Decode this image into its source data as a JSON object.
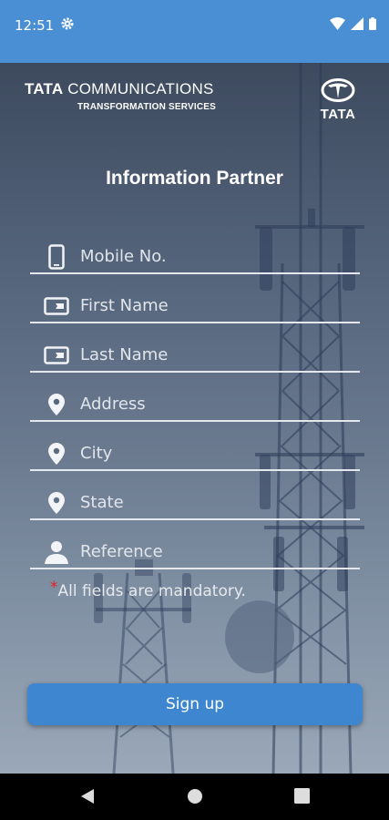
{
  "status_bar": {
    "time": "12:51"
  },
  "header": {
    "brand_bold": "TATA",
    "brand_rest": "COMMUNICATIONS",
    "brand_sub": "TRANSFORMATION SERVICES",
    "logo_word": "TATA"
  },
  "form": {
    "title": "Information Partner",
    "fields": [
      {
        "label": "Mobile No.",
        "icon": "phone-icon"
      },
      {
        "label": "First Name",
        "icon": "id-card-icon"
      },
      {
        "label": "Last Name",
        "icon": "id-card-icon"
      },
      {
        "label": "Address",
        "icon": "location-pin-icon"
      },
      {
        "label": "City",
        "icon": "location-pin-icon"
      },
      {
        "label": "State",
        "icon": "location-pin-icon"
      },
      {
        "label": "Reference",
        "icon": "person-icon"
      }
    ],
    "mandatory_star": "*",
    "mandatory_note": "All fields are mandatory.",
    "submit_label": "Sign up"
  },
  "colors": {
    "accent": "#4a8fd4",
    "button": "#3e86cf",
    "required": "#e02020"
  }
}
